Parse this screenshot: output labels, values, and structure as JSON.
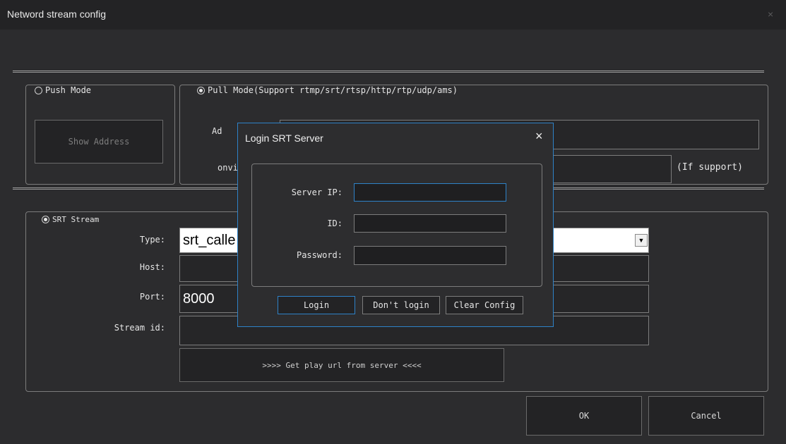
{
  "window": {
    "title": "Netword stream config",
    "close_glyph": "×"
  },
  "push_group": {
    "label": "Push Mode",
    "selected": false,
    "show_address_button": "Show Address"
  },
  "pull_group": {
    "label": "Pull Mode(Support rtmp/srt/rtsp/http/rtp/udp/ams)",
    "selected": true,
    "address_label_fragment": "Ad",
    "onvif_label_fragment": "onvi",
    "support_note": "(If support)"
  },
  "srt_group": {
    "label": "SRT Stream",
    "selected": true,
    "type_label": "Type:",
    "type_value": "srt_calle",
    "dropdown_arrow": "▼",
    "host_label": "Host:",
    "host_value": "",
    "port_label": "Port:",
    "port_value": "8000",
    "stream_id_label": "Stream id:",
    "stream_id_value": "",
    "get_url_button": ">>>> Get play url from server <<<<"
  },
  "footer": {
    "ok": "OK",
    "cancel": "Cancel"
  },
  "login_dialog": {
    "title": "Login SRT Server",
    "close_glyph": "×",
    "server_ip_label": "Server IP:",
    "server_ip_value": "",
    "id_label": "ID:",
    "id_value": "",
    "password_label": "Password:",
    "password_value": "",
    "login_button": "Login",
    "dont_login_button": "Don't login",
    "clear_config_button": "Clear Config"
  },
  "colors": {
    "accent": "#2e82c8",
    "background": "#2c2c2e",
    "titlebar": "#232325"
  }
}
